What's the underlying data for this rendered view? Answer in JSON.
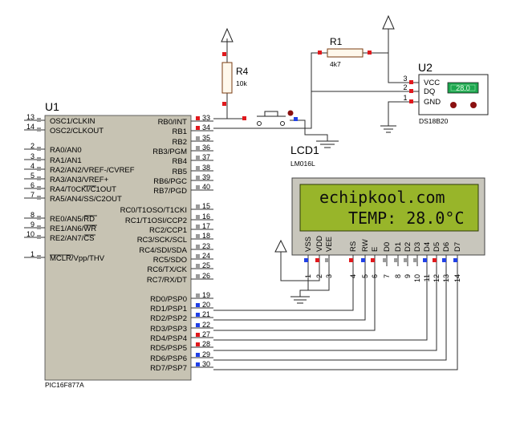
{
  "u1": {
    "ref": "U1",
    "part": "PIC16F877A",
    "left_pins": [
      {
        "num": "13",
        "label": "OSC1/CLKIN",
        "marker": "gray"
      },
      {
        "num": "14",
        "label": "OSC2/CLKOUT",
        "marker": "gray"
      },
      {
        "num": "2",
        "label": "RA0/AN0",
        "marker": "gray"
      },
      {
        "num": "3",
        "label": "RA1/AN1",
        "marker": "gray"
      },
      {
        "num": "4",
        "label": "RA2/AN2/VREF-/CVREF",
        "marker": "gray"
      },
      {
        "num": "5",
        "label": "RA3/AN3/VREF+",
        "marker": "gray"
      },
      {
        "num": "6",
        "label": "RA4/T0CKI/C1OUT",
        "marker": "gray"
      },
      {
        "num": "7",
        "label": "RA5/AN4/SS/C2OUT",
        "marker": "gray"
      },
      {
        "num": "8",
        "label": "RE0/AN5/RD",
        "marker": "gray"
      },
      {
        "num": "9",
        "label": "RE1/AN6/WR",
        "marker": "gray"
      },
      {
        "num": "10",
        "label": "RE2/AN7/CS",
        "marker": "gray"
      },
      {
        "num": "1",
        "label": "MCLR/Vpp/THV",
        "marker": "gray"
      }
    ],
    "right_pins": [
      {
        "num": "33",
        "label": "RB0/INT",
        "marker": "red"
      },
      {
        "num": "34",
        "label": "RB1",
        "marker": "red"
      },
      {
        "num": "35",
        "label": "RB2",
        "marker": "gray"
      },
      {
        "num": "36",
        "label": "RB3/PGM",
        "marker": "gray"
      },
      {
        "num": "37",
        "label": "RB4",
        "marker": "gray"
      },
      {
        "num": "38",
        "label": "RB5",
        "marker": "gray"
      },
      {
        "num": "39",
        "label": "RB6/PGC",
        "marker": "gray"
      },
      {
        "num": "40",
        "label": "RB7/PGD",
        "marker": "gray"
      },
      {
        "num": "15",
        "label": "RC0/T1OSO/T1CKI",
        "marker": "gray"
      },
      {
        "num": "16",
        "label": "RC1/T1OSI/CCP2",
        "marker": "gray"
      },
      {
        "num": "17",
        "label": "RC2/CCP1",
        "marker": "gray"
      },
      {
        "num": "18",
        "label": "RC3/SCK/SCL",
        "marker": "gray"
      },
      {
        "num": "23",
        "label": "RC4/SDI/SDA",
        "marker": "gray"
      },
      {
        "num": "24",
        "label": "RC5/SDO",
        "marker": "gray"
      },
      {
        "num": "25",
        "label": "RC6/TX/CK",
        "marker": "gray"
      },
      {
        "num": "26",
        "label": "RC7/RX/DT",
        "marker": "gray"
      },
      {
        "num": "19",
        "label": "RD0/PSP0",
        "marker": "gray"
      },
      {
        "num": "20",
        "label": "RD1/PSP1",
        "marker": "blue"
      },
      {
        "num": "21",
        "label": "RD2/PSP2",
        "marker": "blue"
      },
      {
        "num": "22",
        "label": "RD3/PSP3",
        "marker": "blue"
      },
      {
        "num": "27",
        "label": "RD4/PSP4",
        "marker": "red"
      },
      {
        "num": "28",
        "label": "RD5/PSP5",
        "marker": "red"
      },
      {
        "num": "29",
        "label": "RD6/PSP6",
        "marker": "blue"
      },
      {
        "num": "30",
        "label": "RD7/PSP7",
        "marker": "blue"
      }
    ]
  },
  "r4": {
    "ref": "R4",
    "value": "10k"
  },
  "r1": {
    "ref": "R1",
    "value": "4k7"
  },
  "u2": {
    "ref": "U2",
    "part": "DS18B20",
    "display": "28.0",
    "pins": [
      {
        "num": "3",
        "label": "VCC"
      },
      {
        "num": "2",
        "label": "DQ"
      },
      {
        "num": "1",
        "label": "GND"
      }
    ]
  },
  "lcd1": {
    "ref": "LCD1",
    "part": "LM016L",
    "line1": "echipkool.com",
    "line2": "TEMP: 28.0°C",
    "pins": [
      {
        "num": "1",
        "label": "VSS",
        "marker": "blue"
      },
      {
        "num": "2",
        "label": "VDD",
        "marker": "red"
      },
      {
        "num": "3",
        "label": "VEE",
        "marker": "gray"
      },
      {
        "num": "4",
        "label": "RS",
        "marker": "red"
      },
      {
        "num": "5",
        "label": "RW",
        "marker": "blue"
      },
      {
        "num": "6",
        "label": "E",
        "marker": "red"
      },
      {
        "num": "7",
        "label": "D0",
        "marker": "gray"
      },
      {
        "num": "8",
        "label": "D1",
        "marker": "gray"
      },
      {
        "num": "9",
        "label": "D2",
        "marker": "gray"
      },
      {
        "num": "10",
        "label": "D3",
        "marker": "gray"
      },
      {
        "num": "11",
        "label": "D4",
        "marker": "blue"
      },
      {
        "num": "12",
        "label": "D5",
        "marker": "red"
      },
      {
        "num": "13",
        "label": "D6",
        "marker": "blue"
      },
      {
        "num": "14",
        "label": "D7",
        "marker": "blue"
      }
    ]
  },
  "colors": {
    "background": "#ffffff",
    "mcu_body": "#c7c3b3",
    "lcd_frame": "#c8c6bc",
    "lcd_screen": "#98b52a",
    "sensor_lcd": "#1ca64e",
    "wire": "#2b2b2b",
    "marker_red": "#e0191d",
    "marker_blue": "#2140e6",
    "marker_gray": "#9a9a9a"
  }
}
